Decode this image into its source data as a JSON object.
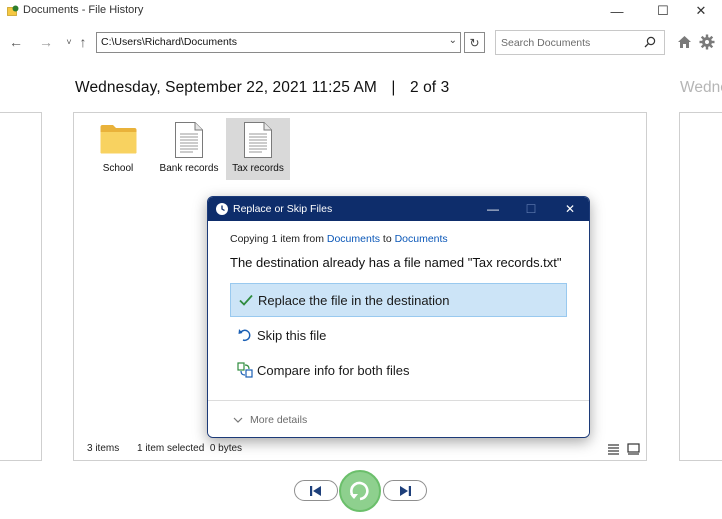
{
  "window": {
    "title": "Documents - File History",
    "controls": {
      "minimize": "—",
      "maximize": "☐",
      "close": "✕"
    }
  },
  "nav": {
    "back": "←",
    "forward": "→",
    "recent": "˅",
    "up": "↑",
    "path": "C:\\Users\\Richard\\Documents",
    "path_dropdown": "⌄",
    "refresh": "↻",
    "search_placeholder": "Search Documents"
  },
  "heading": {
    "date": "Wednesday, September 22, 2021 11:25 AM",
    "separator": "|",
    "position": "2 of 3",
    "next_snapshot_partial": "Wedne"
  },
  "files": [
    {
      "name": "School",
      "type": "folder"
    },
    {
      "name": "Bank records",
      "type": "document"
    },
    {
      "name": "Tax records",
      "type": "document",
      "selected": true
    }
  ],
  "status": {
    "item_count": "3 items",
    "selection": "1 item selected  0 bytes"
  },
  "dialog": {
    "title": "Replace or Skip Files",
    "controls": {
      "minimize": "—",
      "maximize": "☐",
      "close": "✕"
    },
    "copying_prefix": "Copying 1 item from ",
    "source": "Documents",
    "copying_mid": " to ",
    "destination": "Documents",
    "headline": "The destination already has a file named \"Tax records.txt\"",
    "options": [
      {
        "label": "Replace the file in the destination",
        "icon": "checkmark-icon",
        "highlighted": true
      },
      {
        "label": "Skip this file",
        "icon": "skip-icon",
        "highlighted": false
      },
      {
        "label": "Compare info for both files",
        "icon": "compare-icon",
        "highlighted": false
      }
    ],
    "more_details": "More details"
  },
  "colors": {
    "dialog_titlebar": "#0e2d6b",
    "highlight": "#cce4f7",
    "link": "#0a57b8",
    "restore_button": "#8ed08e",
    "folder": "#f5c842"
  }
}
